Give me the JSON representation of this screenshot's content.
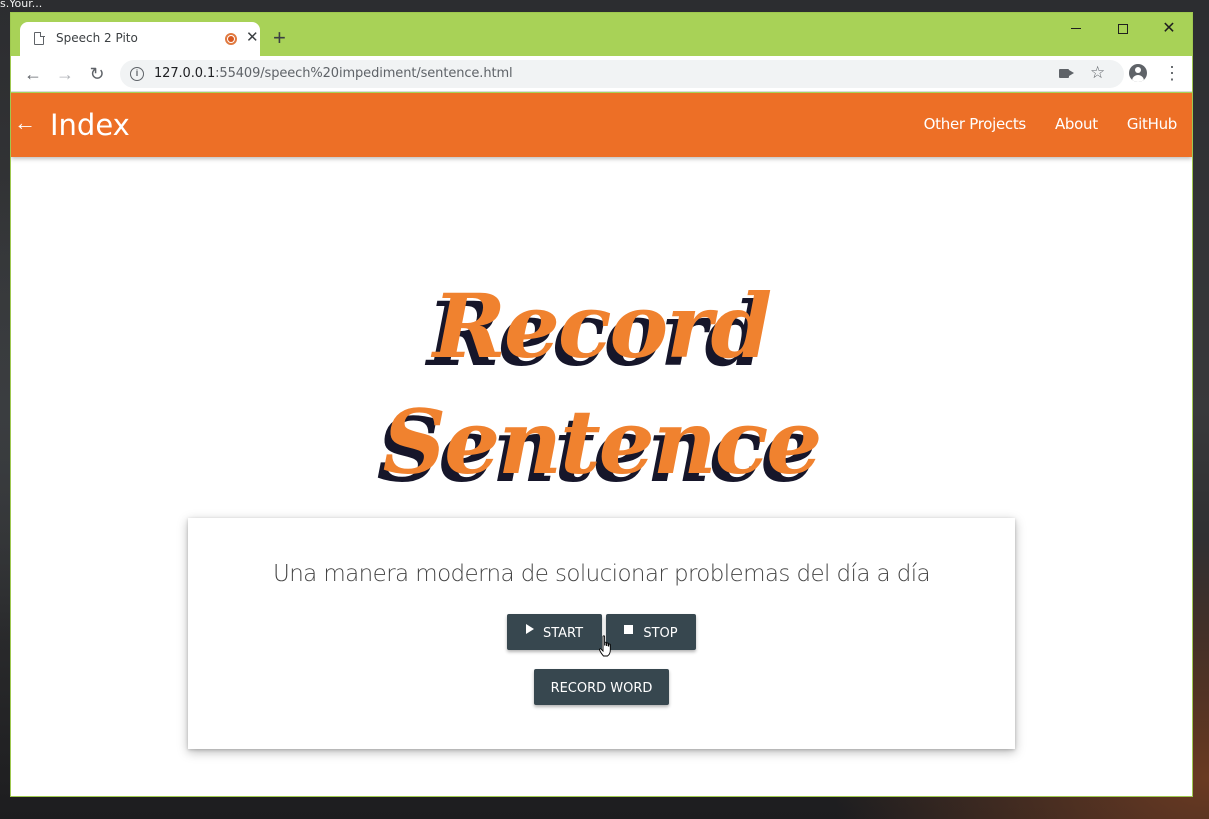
{
  "desktop": {
    "corner_text": "s.Your..."
  },
  "browser": {
    "tab": {
      "title": "Speech 2 Pito",
      "close": "✕"
    },
    "new_tab": "+",
    "window_controls": {
      "close": "✕"
    },
    "nav": {
      "back": "←",
      "forward": "→",
      "reload": "↻"
    },
    "url": {
      "host": "127.0.0.1",
      "path": ":55409/speech%20impediment/sentence.html"
    },
    "star": "☆",
    "menu": "⋮",
    "info": "i"
  },
  "app_bar": {
    "back_icon": "←",
    "brand": "Index",
    "links": [
      "Other Projects",
      "About",
      "GitHub"
    ]
  },
  "hero": {
    "line1": "Record",
    "line2": "Sentence",
    "front_color": "#f0822f",
    "shadow_color": "#16162a"
  },
  "card": {
    "subtitle": "Una manera moderna de solucionar problemas del día a día",
    "start_label": "START",
    "stop_label": "STOP",
    "record_word_label": "RECORD WORD",
    "button_color": "#37474f"
  },
  "colors": {
    "app_bar": "#ed6f26",
    "window_frame": "#a8d257"
  }
}
